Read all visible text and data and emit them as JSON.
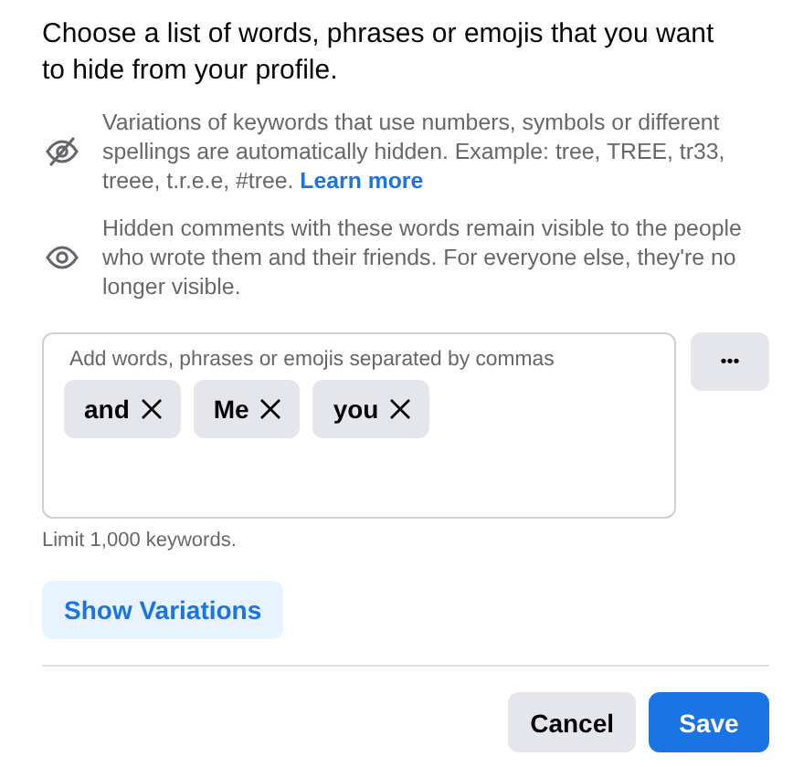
{
  "heading": "Choose a list of words, phrases or emojis that you want to hide from your profile.",
  "info": [
    {
      "kind": "eye-off",
      "text": "Variations of keywords that use numbers, symbols or different spellings are automatically hidden. Example: tree, TREE, tr33, treee, t.r.e.e, #tree.",
      "link": "Learn more"
    },
    {
      "kind": "eye",
      "text": "Hidden comments with these words remain visible to the people who wrote them and their friends. For everyone else, they're no longer visible."
    }
  ],
  "keyword_field": {
    "hint": "Add words, phrases or emojis separated by commas",
    "keywords": [
      "and",
      "Me",
      "you"
    ]
  },
  "more_button": "•••",
  "limit": "Limit 1,000 keywords.",
  "show_variations": "Show Variations",
  "buttons": [
    {
      "kind": "secondary",
      "label": "Cancel"
    },
    {
      "kind": "primary",
      "label": "Save"
    }
  ]
}
